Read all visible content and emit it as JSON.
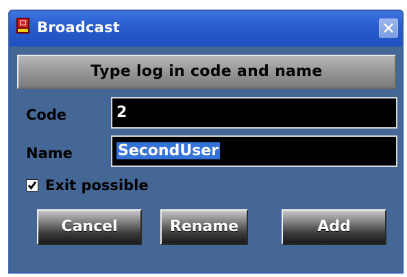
{
  "window": {
    "title": "Broadcast",
    "icon": "red-app-icon",
    "close_icon": "close-icon"
  },
  "banner": {
    "text": "Type log in code and name"
  },
  "fields": {
    "code": {
      "label": "Code",
      "value": "2"
    },
    "name": {
      "label": "Name",
      "value": "SecondUser",
      "selected": true
    }
  },
  "checkbox": {
    "label": "Exit possible",
    "checked": true
  },
  "buttons": {
    "cancel": "Cancel",
    "rename": "Rename",
    "add": "Add"
  },
  "colors": {
    "titlebar": "#2a5ccc",
    "dialog_background": "#456796",
    "field_background": "#000000",
    "selection": "#3573d9"
  }
}
